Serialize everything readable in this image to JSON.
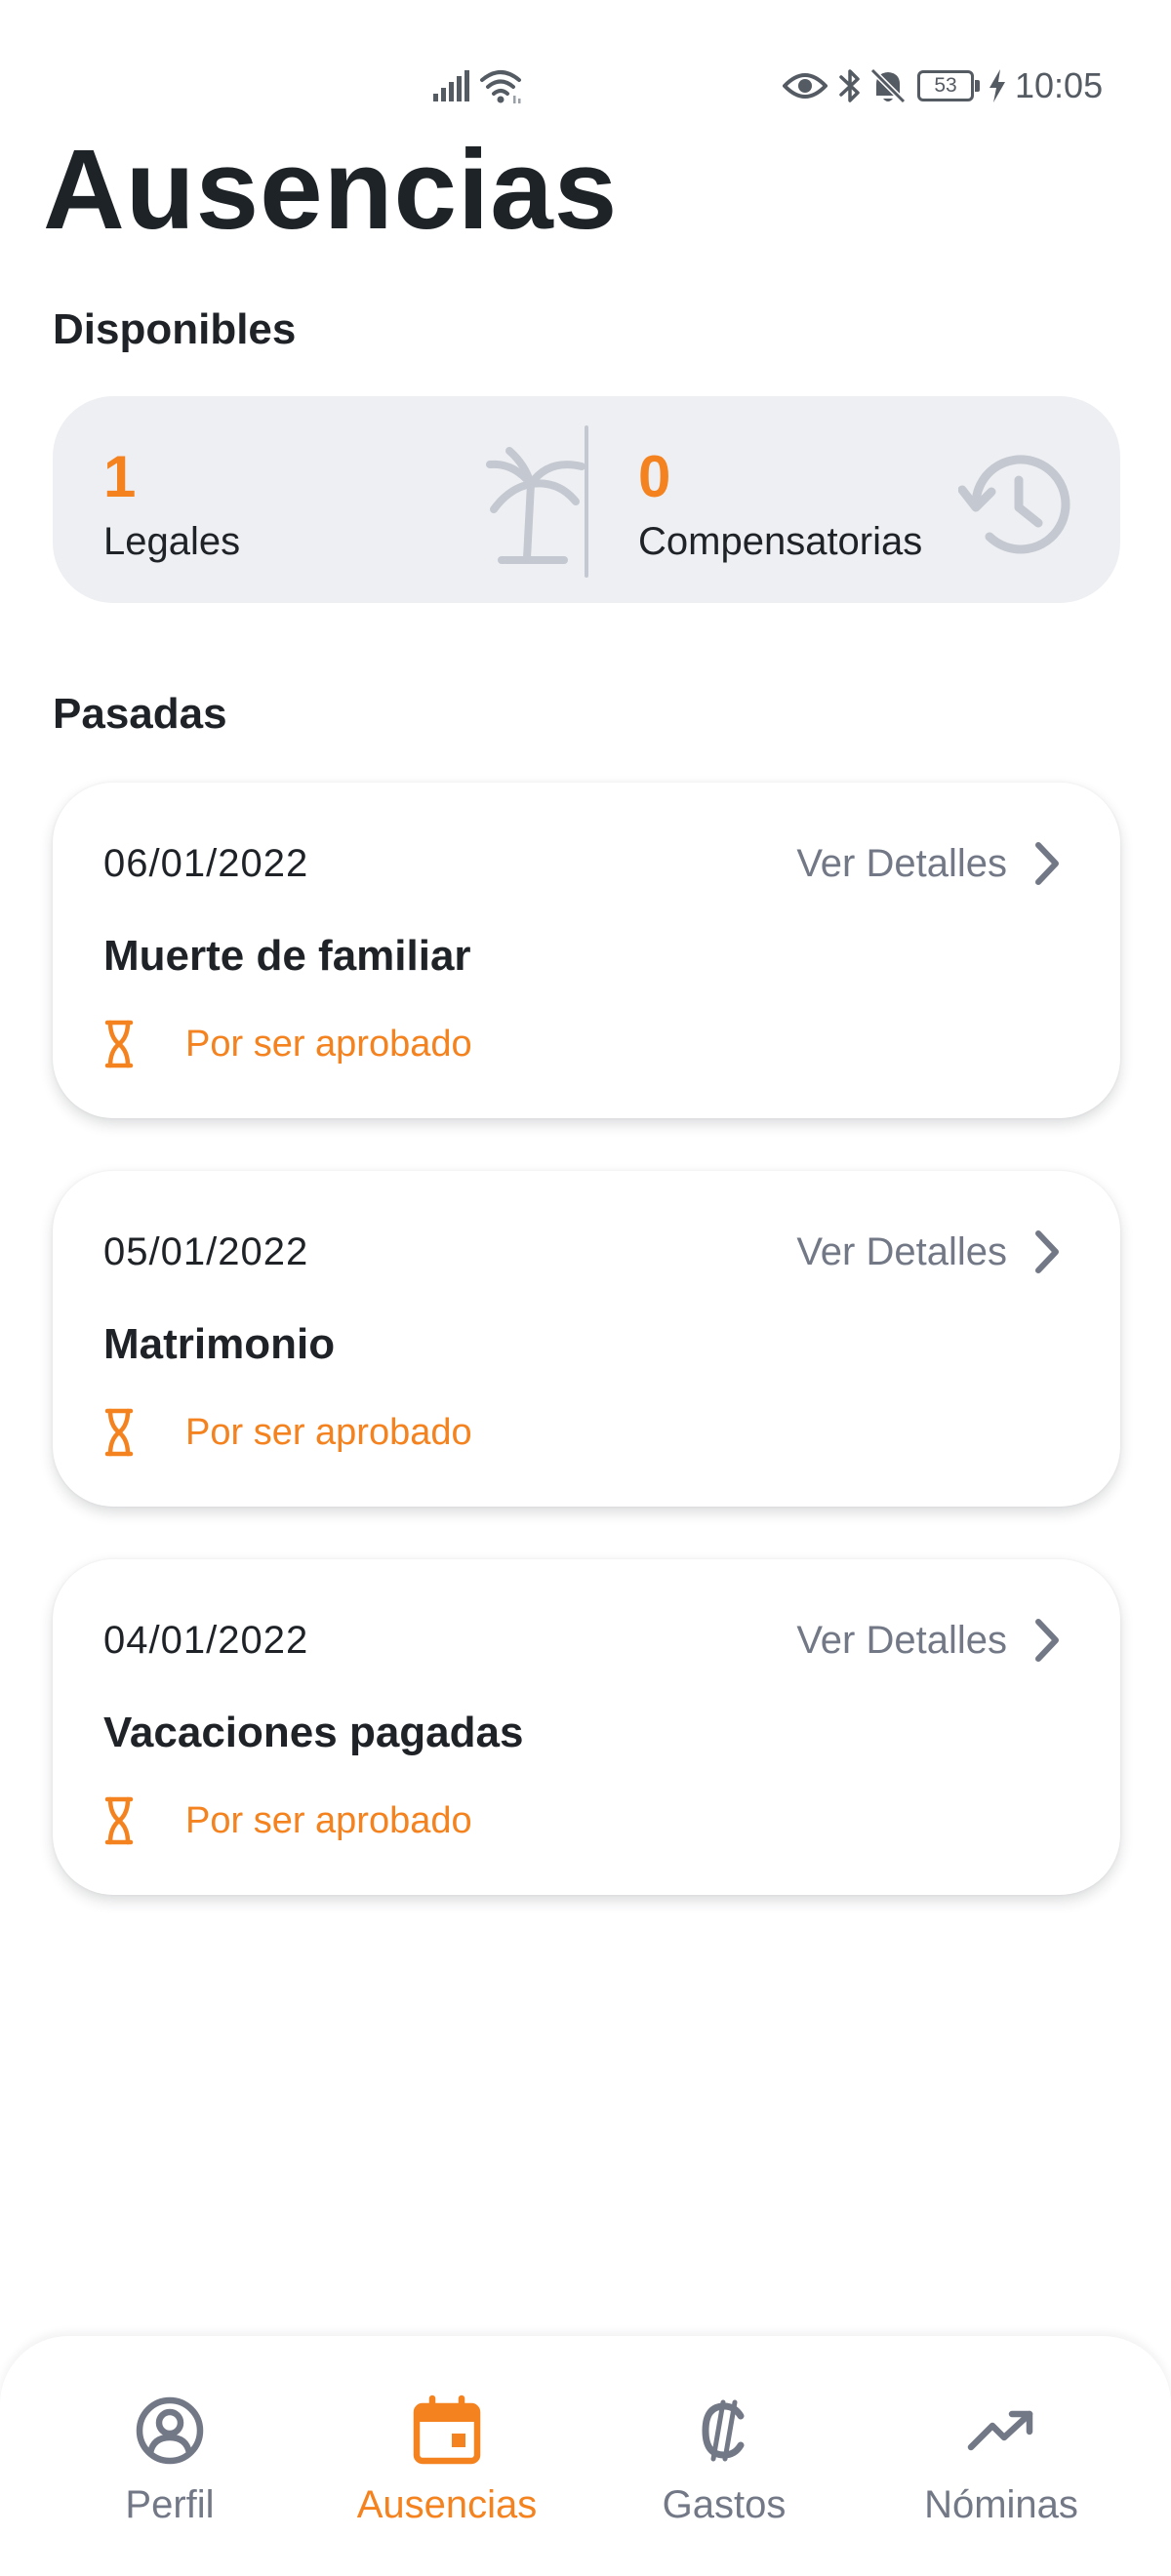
{
  "status_bar": {
    "time": "10:05",
    "battery": "53",
    "icons": [
      "signal-icon",
      "wifi-icon",
      "eye-icon",
      "bluetooth-icon",
      "bell-off-icon",
      "battery-icon",
      "charging-icon"
    ]
  },
  "page": {
    "title": "Ausencias"
  },
  "available": {
    "section_title": "Disponibles",
    "items": [
      {
        "count": "1",
        "label": "Legales",
        "icon": "palm-tree-icon"
      },
      {
        "count": "0",
        "label": "Compensatorias",
        "icon": "history-icon"
      }
    ]
  },
  "past": {
    "section_title": "Pasadas",
    "items": [
      {
        "date": "06/01/2022",
        "details_label": "Ver Detalles",
        "type": "Muerte de familiar",
        "status": "Por ser aprobado"
      },
      {
        "date": "05/01/2022",
        "details_label": "Ver Detalles",
        "type": "Matrimonio",
        "status": "Por ser aprobado"
      },
      {
        "date": "04/01/2022",
        "details_label": "Ver Detalles",
        "type": "Vacaciones pagadas",
        "status": "Por ser aprobado"
      }
    ]
  },
  "bottom_nav": {
    "items": [
      {
        "label": "Perfil",
        "icon": "profile-icon",
        "active": false
      },
      {
        "label": "Ausencias",
        "icon": "calendar-icon",
        "active": true
      },
      {
        "label": "Gastos",
        "icon": "colon-currency-icon",
        "active": false
      },
      {
        "label": "Nóminas",
        "icon": "trending-up-icon",
        "active": false
      }
    ]
  },
  "colors": {
    "accent": "#f4821f",
    "muted": "#727886",
    "text": "#1f2328",
    "summary_bg": "#eeeff3"
  }
}
